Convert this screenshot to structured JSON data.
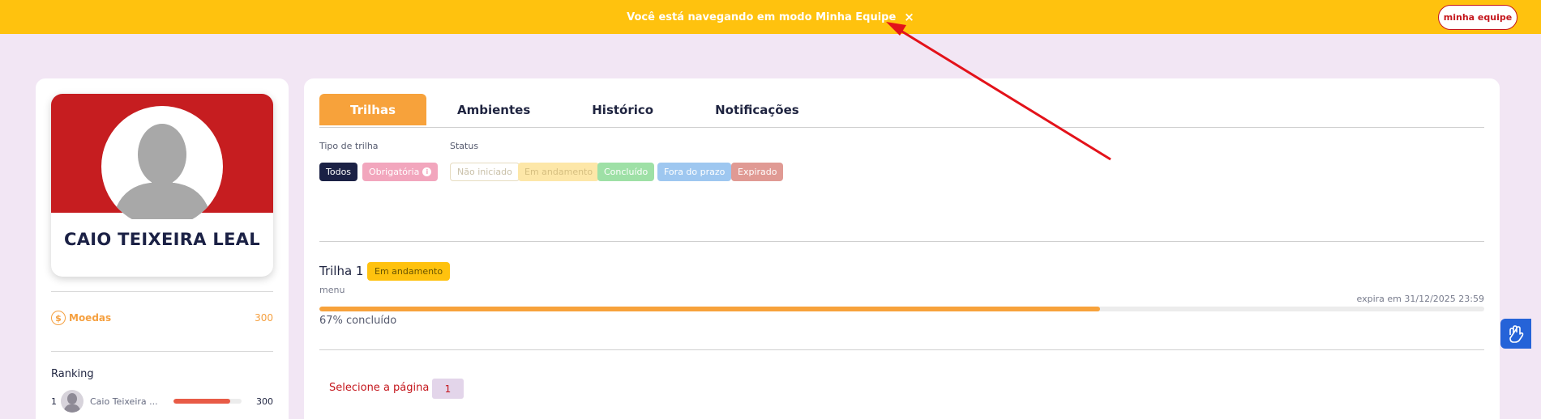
{
  "banner": {
    "text": "Você está navegando em modo Minha Equipe",
    "close_icon": "×",
    "team_button": "minha equipe"
  },
  "profile": {
    "name": "CAIO TEIXEIRA LEAL",
    "coins_icon": "$",
    "coins_label": "Moedas",
    "coins_value": "300"
  },
  "ranking": {
    "title": "Ranking",
    "entries": [
      {
        "position": "1",
        "name": "Caio Teixeira ...",
        "value": "300",
        "bar_fraction": 0.83
      }
    ]
  },
  "tabs": [
    "Trilhas",
    "Ambientes",
    "Histórico",
    "Notificações"
  ],
  "filters": {
    "type_label": "Tipo de trilha",
    "status_label": "Status",
    "type_chips": [
      "Todos",
      "Obrigatória"
    ],
    "info_icon": "i",
    "status_chips": [
      "Não iniciado",
      "Em andamento",
      "Concluído",
      "Fora do prazo",
      "Expirado"
    ]
  },
  "trail": {
    "title": "Trilha 1",
    "status": "Em andamento",
    "subtitle": "menu",
    "expire": "expira em 31/12/2025 23:59",
    "progress_fraction": 0.67,
    "progress_text": "67% concluído"
  },
  "pagination": {
    "label": "Selecione a página",
    "current": "1"
  },
  "colors": {
    "banner": "#ffc20e",
    "brand_red": "#c61d20",
    "accent_orange": "#f7a23b",
    "page_bg": "#f2e6f4",
    "a11y_blue": "#2563d8"
  },
  "icons": {
    "banner_close": "close-icon",
    "coins": "coin-icon",
    "accessibility": "sign-language-icon"
  }
}
